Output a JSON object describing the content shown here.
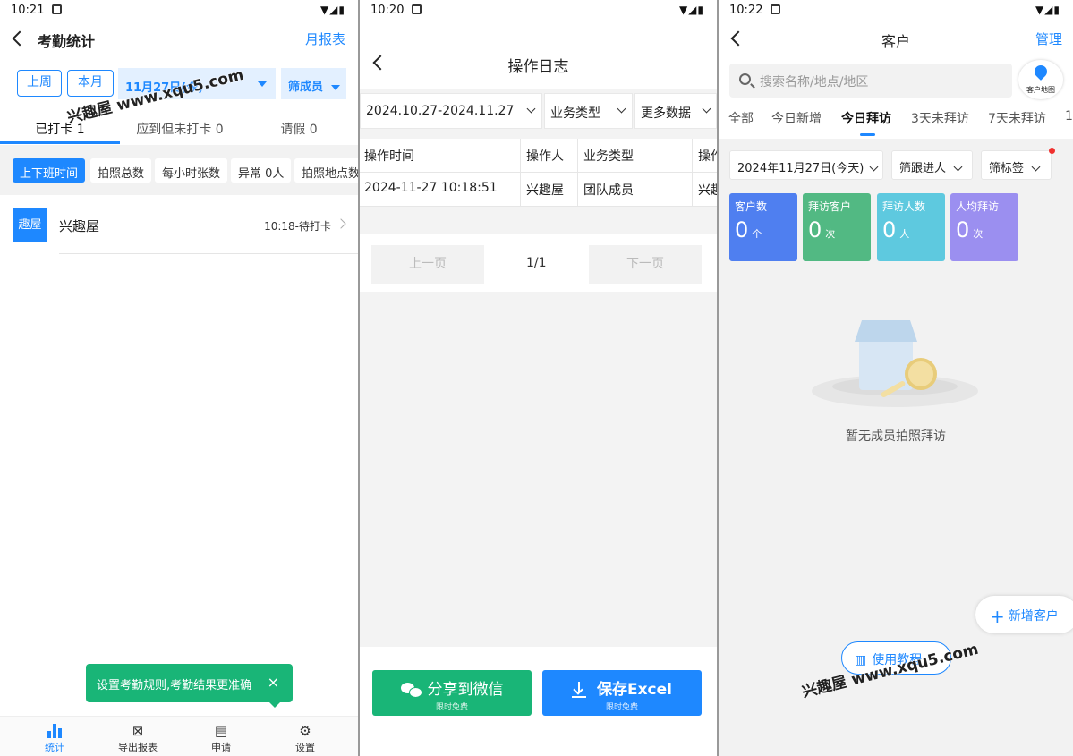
{
  "panel1": {
    "status_time": "10:21",
    "title": "考勤统计",
    "right_action": "月报表",
    "period_week": "上周",
    "period_month": "本月",
    "date": "11月27日(今)",
    "filter": "筛成员",
    "tabs": [
      "已打卡 1",
      "应到但未打卡 0",
      "请假 0"
    ],
    "chips": [
      "上下班时间",
      "拍照总数",
      "每小时张数",
      "异常 0人",
      "拍照地点数"
    ],
    "row": {
      "avatar": "趣屋",
      "name": "兴趣屋",
      "status": "10:18-待打卡"
    },
    "toast": "设置考勤规则,考勤结果更准确",
    "toast_close": "×",
    "nav": [
      "统计",
      "导出报表",
      "申请",
      "设置"
    ],
    "watermark": "兴趣屋 www.xqu5.com"
  },
  "panel2": {
    "status_time": "10:20",
    "title": "操作日志",
    "filters": [
      "2024.10.27-2024.11.27",
      "业务类型",
      "更多数据"
    ],
    "columns": [
      "操作时间",
      "操作人",
      "业务类型",
      "操作"
    ],
    "rows": [
      [
        "2024-11-27 10:18:51",
        "兴趣屋",
        "团队成员",
        "兴趣"
      ]
    ],
    "prev": "上一页",
    "page": "1/1",
    "next": "下一页",
    "share_label": "分享到微信",
    "share_sub": "限时免费",
    "save_label": "保存Excel",
    "save_sub": "限时免费"
  },
  "panel3": {
    "status_time": "10:22",
    "title": "客户",
    "right_action": "管理",
    "search_placeholder": "搜索名称/地点/地区",
    "map_label": "客户地图",
    "tabs": [
      "全部",
      "今日新增",
      "今日拜访",
      "3天未拜访",
      "7天未拜访",
      "1"
    ],
    "filters": [
      "2024年11月27日(今天)",
      "筛跟进人",
      "筛标签"
    ],
    "cards": [
      {
        "label": "客户数",
        "value": "0",
        "unit": "个",
        "color": "#4f7ff0"
      },
      {
        "label": "拜访客户",
        "value": "0",
        "unit": "次",
        "color": "#52b983"
      },
      {
        "label": "拜访人数",
        "value": "0",
        "unit": "人",
        "color": "#5ec9df"
      },
      {
        "label": "人均拜访",
        "value": "0",
        "unit": "次",
        "color": "#9b8ff0"
      }
    ],
    "empty_text": "暂无成员拍照拜访",
    "add_button": "新增客户",
    "use_button": "使用教程",
    "watermark": "兴趣屋 www.xqu5.com"
  },
  "colors": {
    "accent": "#1e88ff",
    "green": "#19b577"
  }
}
